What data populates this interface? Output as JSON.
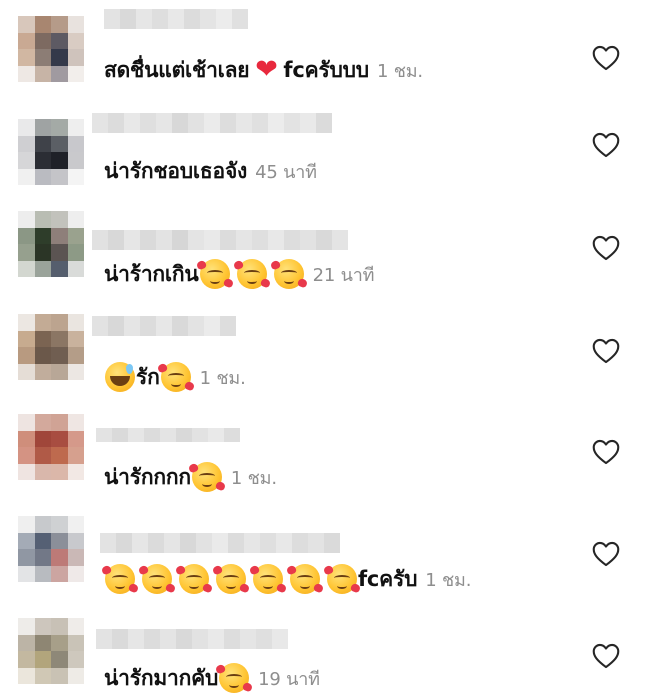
{
  "comments": [
    {
      "text_before": "สดชื่นแต่เช้าเลย",
      "text_after": "fcครับบบ",
      "time": "1 ชม."
    },
    {
      "text_before": "น่ารักชอบเธอจัง",
      "time": "45 นาที"
    },
    {
      "text_before": "น่าร้ากเกิน",
      "time": "21 นาที"
    },
    {
      "text_after": "รัก",
      "time": "1 ชม."
    },
    {
      "text_before": "น่ารักกกก",
      "time": "1 ชม."
    },
    {
      "text_after": "fcครับ",
      "time": "1 ชม."
    },
    {
      "text_before": "น่ารักมากคับ",
      "time": "19 นาที"
    }
  ],
  "icons": {
    "like": "heart-outline-icon",
    "emoji_love": "smiling-face-with-hearts-icon",
    "emoji_sweat": "grinning-face-with-sweat-icon",
    "emoji_heart": "red-heart-icon"
  },
  "colors": {
    "text": "#111111",
    "timestamp": "#8e8e8e",
    "like_icon": "#262626"
  }
}
